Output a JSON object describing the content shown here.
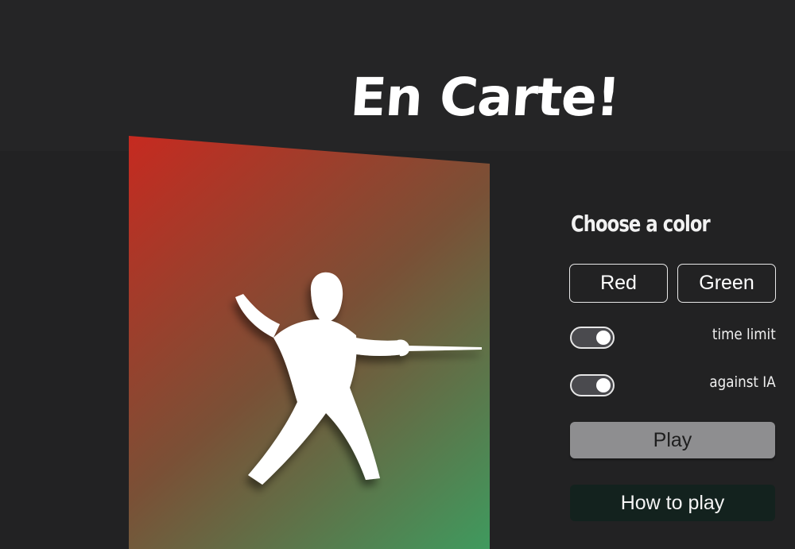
{
  "header": {
    "title": "En Carte!"
  },
  "card": {
    "image_icon": "fencer-icon",
    "gradient": {
      "start": "#c62a20",
      "middle": "#7a5036",
      "end": "#3f9a5e"
    }
  },
  "controls": {
    "choose_label": "Choose a color",
    "color_options": [
      {
        "label": "Red"
      },
      {
        "label": "Green"
      }
    ],
    "toggles": [
      {
        "label": "time limit",
        "state": "on"
      },
      {
        "label": "against IA",
        "state": "on"
      }
    ],
    "play_label": "Play",
    "how_to_play_label": "How to play"
  },
  "colors": {
    "background": "#222223",
    "play_button": "#8e8e90",
    "how_to_play_button": "#13221e"
  }
}
